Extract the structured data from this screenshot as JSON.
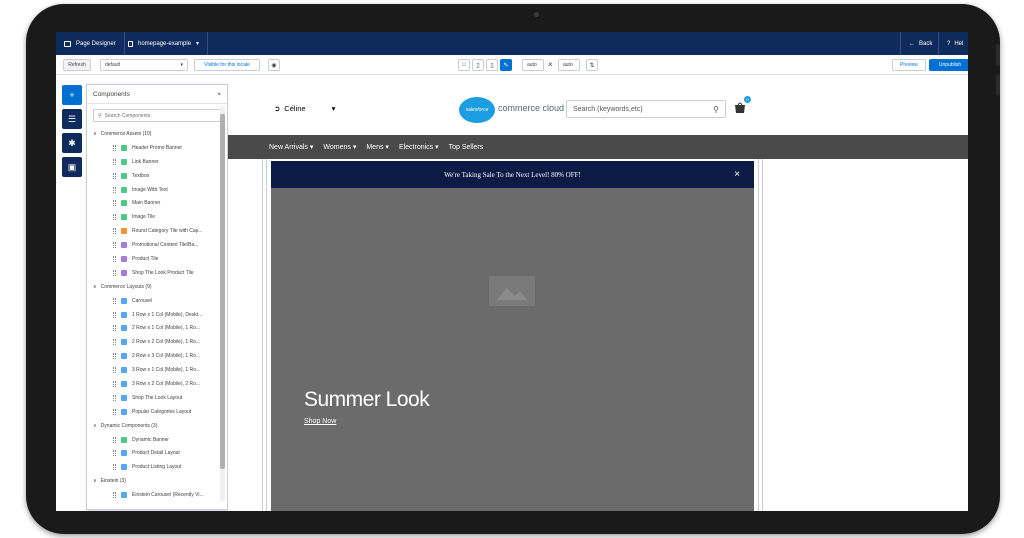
{
  "topbar": {
    "tab1_label": "Page Designer",
    "tab2_label": "homepage-example",
    "back_label": "Back",
    "help_label": "Hel"
  },
  "toolbar": {
    "refresh_label": "Refresh",
    "locale_value": "default",
    "visible_label": "Visible for this locale",
    "width_value": "auto",
    "height_value": "auto",
    "preview_label": "Preview",
    "unpublish_label": "Unpublish"
  },
  "panel": {
    "title": "Components",
    "search_placeholder": "Search Components",
    "groups": [
      {
        "label": "Commerce Assets (10)",
        "items": [
          {
            "label": "Header Promo Banner",
            "color": "#4bca81"
          },
          {
            "label": "Link Banner",
            "color": "#4bca81"
          },
          {
            "label": "Textbox",
            "color": "#4bca81"
          },
          {
            "label": "Image With Text",
            "color": "#4bca81"
          },
          {
            "label": "Main Banner",
            "color": "#4bca81"
          },
          {
            "label": "Image Tile",
            "color": "#4bca81"
          },
          {
            "label": "Round Category Tile with Cap...",
            "color": "#f59331"
          },
          {
            "label": "Promotional Content Tile/Ba...",
            "color": "#a37ce0"
          },
          {
            "label": "Product Tile",
            "color": "#a37ce0"
          },
          {
            "label": "Shop The Look Product Tile",
            "color": "#a37ce0"
          }
        ]
      },
      {
        "label": "Commerce Layouts (9)",
        "items": [
          {
            "label": "Carousel",
            "color": "#54a7f0"
          },
          {
            "label": "1 Row x 1 Col (Mobile), Deskt...",
            "color": "#54a7f0"
          },
          {
            "label": "2 Row x 1 Col (Mobile), 1 Ro...",
            "color": "#54a7f0"
          },
          {
            "label": "2 Row x 2 Col (Mobile), 1 Ro...",
            "color": "#54a7f0"
          },
          {
            "label": "2 Row x 3 Col (Mobile), 1 Ro...",
            "color": "#54a7f0"
          },
          {
            "label": "3 Row x 1 Col (Mobile), 1 Ro...",
            "color": "#54a7f0"
          },
          {
            "label": "3 Row x 2 Col (Mobile), 2 Ro...",
            "color": "#54a7f0"
          },
          {
            "label": "Shop The Look Layout",
            "color": "#54a7f0"
          },
          {
            "label": "Popular Categories Layout",
            "color": "#54a7f0"
          }
        ]
      },
      {
        "label": "Dynamic Components (3)",
        "items": [
          {
            "label": "Dynamic Banner",
            "color": "#4bca81"
          },
          {
            "label": "Product Detail Layout",
            "color": "#54a7f0"
          },
          {
            "label": "Product Listing Layout",
            "color": "#54a7f0"
          }
        ]
      },
      {
        "label": "Einstein (3)",
        "items": [
          {
            "label": "Einstein Carousel (Recently Vi...",
            "color": "#54a7f0"
          }
        ]
      }
    ]
  },
  "store": {
    "locale_label": "Céline",
    "logo_text": "salesforce",
    "brand_text": "commerce cloud",
    "search_placeholder": "Search (keywords,etc)",
    "cart_count": "0",
    "nav": [
      "New Arrivals",
      "Womens",
      "Mens",
      "Electronics",
      "Top Sellers"
    ],
    "promo_text": "We're Taking Sale To the Next Level! 80% OFF!",
    "hero_title": "Summer Look",
    "hero_link": "Shop Now"
  }
}
